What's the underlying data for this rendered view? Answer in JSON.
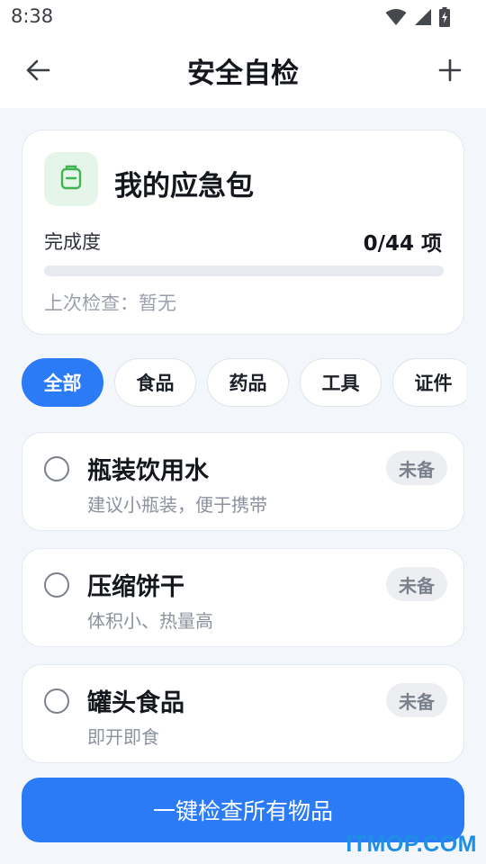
{
  "status_bar": {
    "time": "8:38",
    "icons": [
      "wifi-icon",
      "signal-icon",
      "battery-charging-icon"
    ]
  },
  "header": {
    "title": "安全自检",
    "back_icon": "arrow-left-icon",
    "add_icon": "plus-icon"
  },
  "summary": {
    "title": "我的应急包",
    "icon": "backpack-icon",
    "progress_label": "完成度",
    "progress_count": "0/44 项",
    "progress_fraction": 0,
    "last_check": "上次检查：暂无"
  },
  "categories": [
    {
      "label": "全部",
      "active": true
    },
    {
      "label": "食品",
      "active": false
    },
    {
      "label": "药品",
      "active": false
    },
    {
      "label": "工具",
      "active": false
    },
    {
      "label": "证件",
      "active": false
    }
  ],
  "items": [
    {
      "name": "瓶装饮用水",
      "desc": "建议小瓶装，便于携带",
      "status": "未备"
    },
    {
      "name": "压缩饼干",
      "desc": "体积小、热量高",
      "status": "未备"
    },
    {
      "name": "罐头食品",
      "desc": "即开即食",
      "status": "未备"
    }
  ],
  "footer": {
    "check_all_label": "一键检查所有物品"
  },
  "watermark": "ITMOP.COM",
  "colors": {
    "accent": "#2b7bf6",
    "kit_icon": "#3fb34f",
    "kit_icon_bg": "#e6f5e9",
    "watermark": "#1f8fe6"
  }
}
